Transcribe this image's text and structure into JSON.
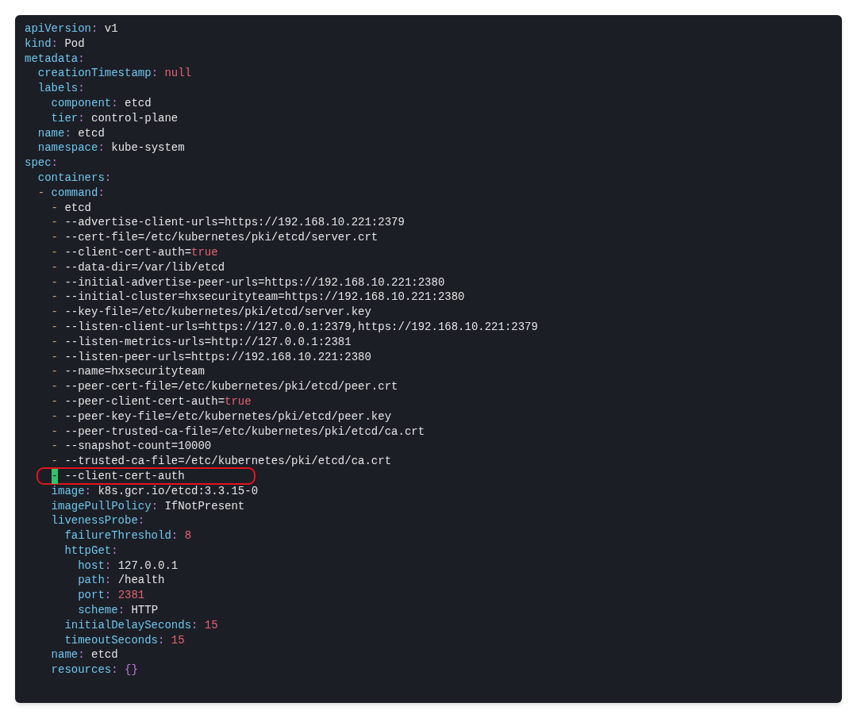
{
  "editor": {
    "lines": [
      {
        "parts": [
          {
            "text": "apiVersion",
            "kind": "key"
          },
          {
            "text": ":",
            "kind": "colon"
          },
          {
            "text": "v1",
            "kind": "string"
          }
        ]
      },
      {
        "parts": [
          {
            "text": "kind",
            "kind": "key"
          },
          {
            "text": ":",
            "kind": "colon"
          },
          {
            "text": "Pod",
            "kind": "string"
          }
        ]
      },
      {
        "parts": [
          {
            "text": "metadata",
            "kind": "key"
          },
          {
            "text": ":",
            "kind": "colon"
          }
        ],
        "children": [
          {
            "parts": [
              {
                "text": "creationTimestamp",
                "kind": "key"
              },
              {
                "text": ":",
                "kind": "colon"
              },
              {
                "text": "null",
                "kind": "literal"
              }
            ]
          },
          {
            "parts": [
              {
                "text": "labels",
                "kind": "key"
              },
              {
                "text": ":",
                "kind": "colon"
              }
            ],
            "children": [
              {
                "parts": [
                  {
                    "text": "component",
                    "kind": "key"
                  },
                  {
                    "text": ":",
                    "kind": "colon"
                  },
                  {
                    "text": "etcd",
                    "kind": "string"
                  }
                ]
              },
              {
                "parts": [
                  {
                    "text": "tier",
                    "kind": "key"
                  },
                  {
                    "text": ":",
                    "kind": "colon"
                  },
                  {
                    "text": "control-plane",
                    "kind": "string"
                  }
                ]
              }
            ]
          },
          {
            "parts": [
              {
                "text": "name",
                "kind": "key"
              },
              {
                "text": ":",
                "kind": "colon"
              },
              {
                "text": "etcd",
                "kind": "string"
              }
            ]
          },
          {
            "parts": [
              {
                "text": "namespace",
                "kind": "key"
              },
              {
                "text": ":",
                "kind": "colon"
              },
              {
                "text": "kube-system",
                "kind": "string"
              }
            ]
          }
        ]
      },
      {
        "parts": [
          {
            "text": "spec",
            "kind": "key"
          },
          {
            "text": ":",
            "kind": "colon"
          }
        ],
        "children": [
          {
            "parts": [
              {
                "text": "containers",
                "kind": "key"
              },
              {
                "text": ":",
                "kind": "colon"
              }
            ],
            "children": [
              {
                "parts": [
                  {
                    "text": "-",
                    "kind": "dash"
                  }
                ],
                "children": [
                  {
                    "parts": [
                      {
                        "text": "command",
                        "kind": "key"
                      },
                      {
                        "text": ":",
                        "kind": "colon"
                      }
                    ],
                    "children": [
                      {
                        "parts": [
                          {
                            "text": "-",
                            "kind": "dash"
                          },
                          {
                            "text": "etcd",
                            "kind": "string"
                          }
                        ],
                        "highlighted": false
                      },
                      {
                        "parts": [
                          {
                            "text": "-",
                            "kind": "dash"
                          },
                          {
                            "text": "--advertise-client-urls=https://192.168.10.221:2379",
                            "kind": "string"
                          }
                        ],
                        "highlighted": false
                      },
                      {
                        "parts": [
                          {
                            "text": "-",
                            "kind": "dash"
                          },
                          {
                            "text": "--cert-file=/etc/kubernetes/pki/etcd/server.crt",
                            "kind": "string"
                          }
                        ],
                        "highlighted": false
                      },
                      {
                        "parts": [
                          {
                            "text": "-",
                            "kind": "dash"
                          },
                          {
                            "text": "--client-cert-auth=",
                            "kind": "string"
                          },
                          {
                            "text": "true",
                            "kind": "literal"
                          }
                        ],
                        "highlighted": false
                      },
                      {
                        "parts": [
                          {
                            "text": "-",
                            "kind": "dash"
                          },
                          {
                            "text": "--data-dir=/var/lib/etcd",
                            "kind": "string"
                          }
                        ],
                        "highlighted": false
                      },
                      {
                        "parts": [
                          {
                            "text": "-",
                            "kind": "dash"
                          },
                          {
                            "text": "--initial-advertise-peer-urls=https://192.168.10.221:2380",
                            "kind": "string"
                          }
                        ],
                        "highlighted": false
                      },
                      {
                        "parts": [
                          {
                            "text": "-",
                            "kind": "dash"
                          },
                          {
                            "text": "--initial-cluster=hxsecurityteam=https://192.168.10.221:2380",
                            "kind": "string"
                          }
                        ],
                        "highlighted": false
                      },
                      {
                        "parts": [
                          {
                            "text": "-",
                            "kind": "dash"
                          },
                          {
                            "text": "--key-file=/etc/kubernetes/pki/etcd/server.key",
                            "kind": "string"
                          }
                        ],
                        "highlighted": false
                      },
                      {
                        "parts": [
                          {
                            "text": "-",
                            "kind": "dash"
                          },
                          {
                            "text": "--listen-client-urls=https://127.0.0.1:2379,https://192.168.10.221:2379",
                            "kind": "string"
                          }
                        ],
                        "highlighted": false
                      },
                      {
                        "parts": [
                          {
                            "text": "-",
                            "kind": "dash"
                          },
                          {
                            "text": "--listen-metrics-urls=http://127.0.0.1:2381",
                            "kind": "string"
                          }
                        ],
                        "highlighted": false
                      },
                      {
                        "parts": [
                          {
                            "text": "-",
                            "kind": "dash"
                          },
                          {
                            "text": "--listen-peer-urls=https://192.168.10.221:2380",
                            "kind": "string"
                          }
                        ],
                        "highlighted": false
                      },
                      {
                        "parts": [
                          {
                            "text": "-",
                            "kind": "dash"
                          },
                          {
                            "text": "--name=hxsecurityteam",
                            "kind": "string"
                          }
                        ],
                        "highlighted": false
                      },
                      {
                        "parts": [
                          {
                            "text": "-",
                            "kind": "dash"
                          },
                          {
                            "text": "--peer-cert-file=/etc/kubernetes/pki/etcd/peer.crt",
                            "kind": "string"
                          }
                        ],
                        "highlighted": false
                      },
                      {
                        "parts": [
                          {
                            "text": "-",
                            "kind": "dash"
                          },
                          {
                            "text": "--peer-client-cert-auth=",
                            "kind": "string"
                          },
                          {
                            "text": "true",
                            "kind": "literal"
                          }
                        ],
                        "highlighted": false
                      },
                      {
                        "parts": [
                          {
                            "text": "-",
                            "kind": "dash"
                          },
                          {
                            "text": "--peer-key-file=/etc/kubernetes/pki/etcd/peer.key",
                            "kind": "string"
                          }
                        ],
                        "highlighted": false
                      },
                      {
                        "parts": [
                          {
                            "text": "-",
                            "kind": "dash"
                          },
                          {
                            "text": "--peer-trusted-ca-file=/etc/kubernetes/pki/etcd/ca.crt",
                            "kind": "string"
                          }
                        ],
                        "highlighted": false
                      },
                      {
                        "parts": [
                          {
                            "text": "-",
                            "kind": "dash"
                          },
                          {
                            "text": "--snapshot-count=10000",
                            "kind": "string"
                          }
                        ],
                        "highlighted": false
                      },
                      {
                        "parts": [
                          {
                            "text": "-",
                            "kind": "dash"
                          },
                          {
                            "text": "--trusted-ca-file=/etc/kubernetes/pki/etcd/ca.crt",
                            "kind": "string"
                          }
                        ],
                        "highlighted": false
                      },
                      {
                        "parts": [
                          {
                            "text": "-",
                            "kind": "dash"
                          },
                          {
                            "text": "--client-cert-auth",
                            "kind": "string"
                          }
                        ],
                        "highlighted": true
                      }
                    ]
                  },
                  {
                    "parts": [
                      {
                        "text": "image",
                        "kind": "key"
                      },
                      {
                        "text": ":",
                        "kind": "colon"
                      },
                      {
                        "text": "k8s.gcr.io/etcd:3.3.15-0",
                        "kind": "string"
                      }
                    ]
                  },
                  {
                    "parts": [
                      {
                        "text": "imagePullPolicy",
                        "kind": "key"
                      },
                      {
                        "text": ":",
                        "kind": "colon"
                      },
                      {
                        "text": "IfNotPresent",
                        "kind": "string"
                      }
                    ]
                  },
                  {
                    "parts": [
                      {
                        "text": "livenessProbe",
                        "kind": "key"
                      },
                      {
                        "text": ":",
                        "kind": "colon"
                      }
                    ],
                    "children": [
                      {
                        "parts": [
                          {
                            "text": "failureThreshold",
                            "kind": "key"
                          },
                          {
                            "text": ":",
                            "kind": "colon"
                          },
                          {
                            "text": "8",
                            "kind": "number"
                          }
                        ]
                      },
                      {
                        "parts": [
                          {
                            "text": "httpGet",
                            "kind": "key"
                          },
                          {
                            "text": ":",
                            "kind": "colon"
                          }
                        ],
                        "children": [
                          {
                            "parts": [
                              {
                                "text": "host",
                                "kind": "key"
                              },
                              {
                                "text": ":",
                                "kind": "colon"
                              },
                              {
                                "text": "127.0.0.1",
                                "kind": "string"
                              }
                            ]
                          },
                          {
                            "parts": [
                              {
                                "text": "path",
                                "kind": "key"
                              },
                              {
                                "text": ":",
                                "kind": "colon"
                              },
                              {
                                "text": "/health",
                                "kind": "string"
                              }
                            ]
                          },
                          {
                            "parts": [
                              {
                                "text": "port",
                                "kind": "key"
                              },
                              {
                                "text": ":",
                                "kind": "colon"
                              },
                              {
                                "text": "2381",
                                "kind": "number"
                              }
                            ]
                          },
                          {
                            "parts": [
                              {
                                "text": "scheme",
                                "kind": "key"
                              },
                              {
                                "text": ":",
                                "kind": "colon"
                              },
                              {
                                "text": "HTTP",
                                "kind": "string"
                              }
                            ]
                          }
                        ]
                      },
                      {
                        "parts": [
                          {
                            "text": "initialDelaySeconds",
                            "kind": "key"
                          },
                          {
                            "text": ":",
                            "kind": "colon"
                          },
                          {
                            "text": "15",
                            "kind": "number"
                          }
                        ]
                      },
                      {
                        "parts": [
                          {
                            "text": "timeoutSeconds",
                            "kind": "key"
                          },
                          {
                            "text": ":",
                            "kind": "colon"
                          },
                          {
                            "text": "15",
                            "kind": "number"
                          }
                        ]
                      }
                    ]
                  },
                  {
                    "parts": [
                      {
                        "text": "name",
                        "kind": "key"
                      },
                      {
                        "text": ":",
                        "kind": "colon"
                      },
                      {
                        "text": "etcd",
                        "kind": "string"
                      }
                    ]
                  },
                  {
                    "parts": [
                      {
                        "text": "resources",
                        "kind": "key"
                      },
                      {
                        "text": ":",
                        "kind": "colon"
                      },
                      {
                        "text": "{}",
                        "kind": "braces"
                      }
                    ]
                  }
                ]
              }
            ]
          }
        ]
      }
    ]
  }
}
